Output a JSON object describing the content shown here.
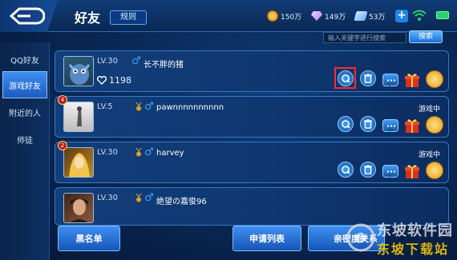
{
  "header": {
    "title": "好友",
    "rules_label": "规则"
  },
  "currencies": [
    {
      "name": "gold-coin",
      "value": "150万"
    },
    {
      "name": "diamond",
      "value": "149万"
    },
    {
      "name": "voucher",
      "value": "53万"
    }
  ],
  "search": {
    "placeholder": "输入关键字进行搜索",
    "button_label": "搜索"
  },
  "sidebar": {
    "items": [
      {
        "label": "QQ好友",
        "active": false
      },
      {
        "label": "游戏好友",
        "active": true
      },
      {
        "label": "附近的人",
        "active": false
      },
      {
        "label": "师徒",
        "active": false
      }
    ]
  },
  "friends": [
    {
      "level": "LV.30",
      "name": "长不胖的猪",
      "intimacy": "1198",
      "status": "",
      "rank": ""
    },
    {
      "level": "LV.5",
      "name": "pawnnnnnnnnnn",
      "intimacy": "",
      "status": "游戏中",
      "rank": "4"
    },
    {
      "level": "LV.30",
      "name": "harvey",
      "intimacy": "",
      "status": "游戏中",
      "rank": "2"
    },
    {
      "level": "LV.30",
      "name": "绝望の嘉俊96",
      "intimacy": "",
      "status": "",
      "rank": ""
    }
  ],
  "bottom": {
    "blacklist_label": "黑名单",
    "requests_label": "申请列表",
    "relations_label": "亲密度关系"
  },
  "watermark": {
    "line1": "东坡软件园",
    "line2": "东坡下载站"
  },
  "colors": {
    "accent": "#3f8ff2",
    "highlight": "#ff2a2a",
    "gift": "#d9301f",
    "coin": "#e59c17"
  }
}
